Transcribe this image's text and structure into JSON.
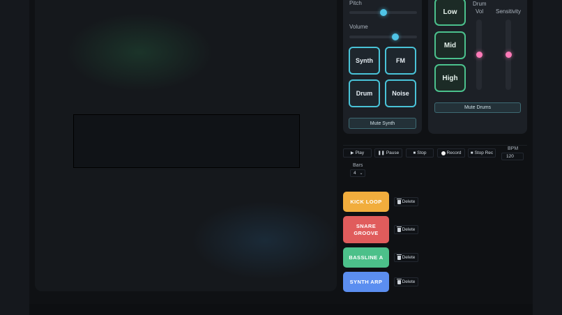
{
  "synth": {
    "pitch_label": "Pitch",
    "pitch_value": 0.5,
    "volume_label": "Volume",
    "volume_value": 0.68,
    "pads": [
      "Synth",
      "FM",
      "Drum",
      "Noise"
    ],
    "mute_label": "Mute Synth",
    "accent_color": "#49c3d8"
  },
  "drums": {
    "vol_label_line1": "Drum",
    "vol_label_line2": "Vol",
    "sensitivity_label": "Sensitivity",
    "vol_value": 0.5,
    "sensitivity_value": 0.5,
    "pads": [
      "Low",
      "Mid",
      "High"
    ],
    "mute_label": "Mute Drums",
    "accent_color": "#4bc18d",
    "thumb_color": "#ff7ab8"
  },
  "transport": {
    "play_icon": "play-icon",
    "play_label": "Play",
    "pause_icon": "pause-icon",
    "pause_label": "Pause",
    "stop_icon": "stop-icon",
    "stop_label": "Stop",
    "record_icon": "record-dot-icon",
    "record_label": "Record",
    "stoprec_icon": "stop-icon",
    "stoprec_label": "Stop Rec",
    "bpm_label": "BPM",
    "bpm_value": "120",
    "bars_label": "Bars",
    "bars_value": "4"
  },
  "loops": [
    {
      "label": "KICK LOOP",
      "color": "#f1ad3d"
    },
    {
      "label": "SNARE GROOVE",
      "color": "#e05c5c"
    },
    {
      "label": "BASSLINE A",
      "color": "#4cc08a"
    },
    {
      "label": "SYNTH ARP",
      "color": "#5b8ef0"
    }
  ],
  "delete_label": "Delete"
}
